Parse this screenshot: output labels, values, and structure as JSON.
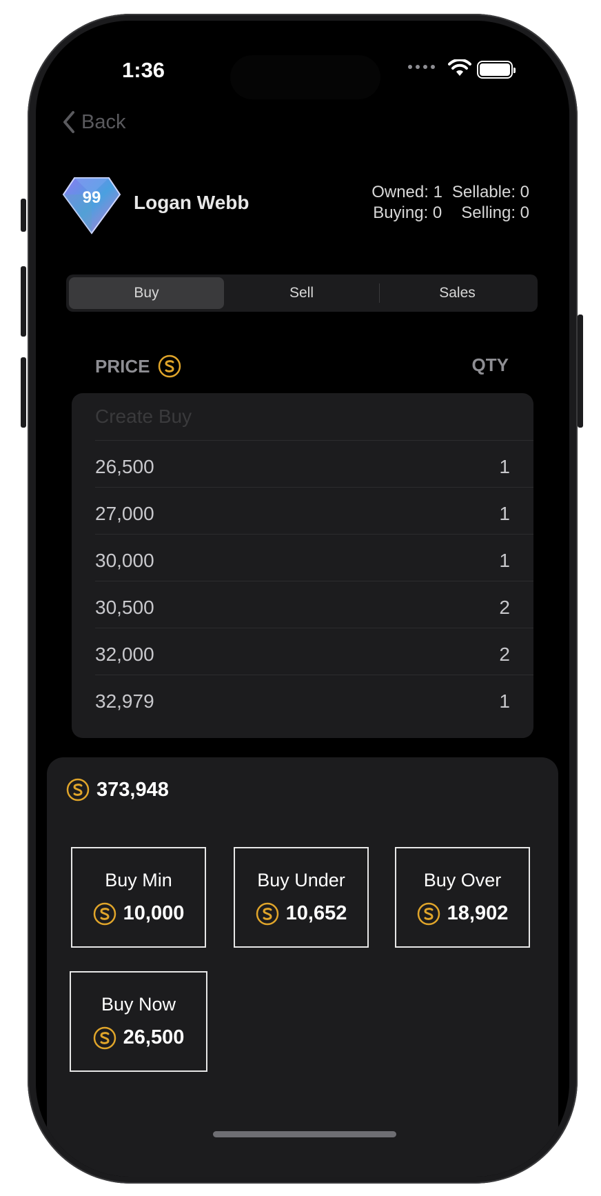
{
  "status_bar": {
    "time": "1:36"
  },
  "nav": {
    "back_label": "Back"
  },
  "player": {
    "name": "Logan Webb",
    "rating": "99",
    "owned": "Owned: 1",
    "sellable": "Sellable: 0",
    "buying": "Buying: 0",
    "selling": "Selling: 0"
  },
  "tabs": [
    {
      "label": "Buy",
      "active": true
    },
    {
      "label": "Sell",
      "active": false
    },
    {
      "label": "Sales",
      "active": false
    }
  ],
  "table": {
    "price_header": "PRICE",
    "qty_header": "QTY",
    "create_placeholder": "Create Buy",
    "rows": [
      {
        "price": "26,500",
        "qty": "1"
      },
      {
        "price": "27,000",
        "qty": "1"
      },
      {
        "price": "30,000",
        "qty": "1"
      },
      {
        "price": "30,500",
        "qty": "2"
      },
      {
        "price": "32,000",
        "qty": "2"
      },
      {
        "price": "32,979",
        "qty": "1"
      }
    ]
  },
  "sheet": {
    "balance": "373,948",
    "actions": [
      {
        "label": "Buy Min",
        "price": "10,000"
      },
      {
        "label": "Buy Under",
        "price": "10,652"
      },
      {
        "label": "Buy Over",
        "price": "18,902"
      },
      {
        "label": "Buy Now",
        "price": "26,500"
      }
    ]
  },
  "colors": {
    "background": "#000000",
    "surface": "#1c1c1e",
    "coin_accent": "#e0a52a",
    "text": "#e8e8e8"
  },
  "icons": [
    "chevron-left-icon",
    "wifi-icon",
    "battery-icon",
    "coin-icon",
    "diamond-rating-icon"
  ]
}
